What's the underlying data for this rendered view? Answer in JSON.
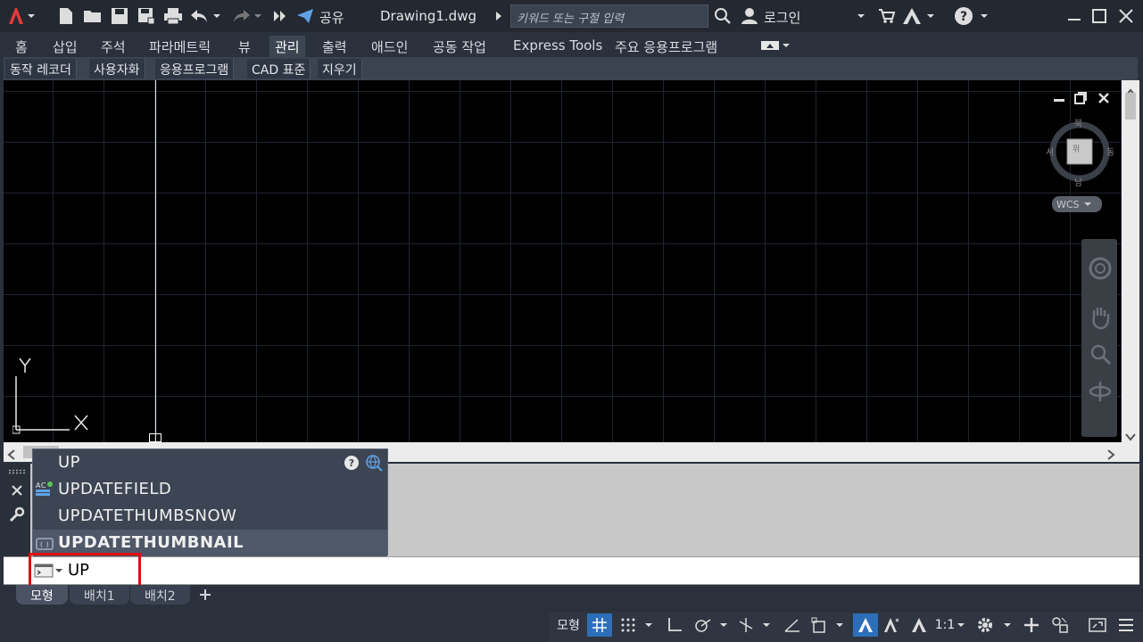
{
  "titlebar": {
    "share_label": "공유",
    "document_title": "Drawing1.dwg",
    "search_placeholder": "키워드 또는 구절 입력",
    "login_label": "로그인"
  },
  "ribbon_tabs": [
    "홈",
    "삽입",
    "주석",
    "파라메트릭",
    "뷰",
    "관리",
    "출력",
    "애드인",
    "공동 작업",
    "Express Tools",
    "주요 응용프로그램"
  ],
  "active_tab": "관리",
  "ribbon_panels": [
    "동작 레코더",
    "사용자화",
    "응용프로그램",
    "CAD 표준",
    "지우기"
  ],
  "viewcube": {
    "north": "북",
    "south": "남",
    "east": "동",
    "west": "서",
    "top_face": "위",
    "wcs_label": "WCS"
  },
  "ucs": {
    "y_label": "Y",
    "x_label": "X"
  },
  "autocomplete": {
    "header": "UP",
    "items": [
      "UPDATEFIELD",
      "UPDATETHUMBSNOW",
      "UPDATETHUMBNAIL"
    ]
  },
  "command_input": {
    "value": "UP"
  },
  "layout_tabs": [
    "모형",
    "배치1",
    "배치2"
  ],
  "status_bar": {
    "model_label": "모형",
    "scale_label": "1:1"
  },
  "colors": {
    "app_red": "#e03a3a",
    "highlight_box": "#e01010",
    "status_active": "#2c6fb8",
    "canvas": "#000000"
  }
}
